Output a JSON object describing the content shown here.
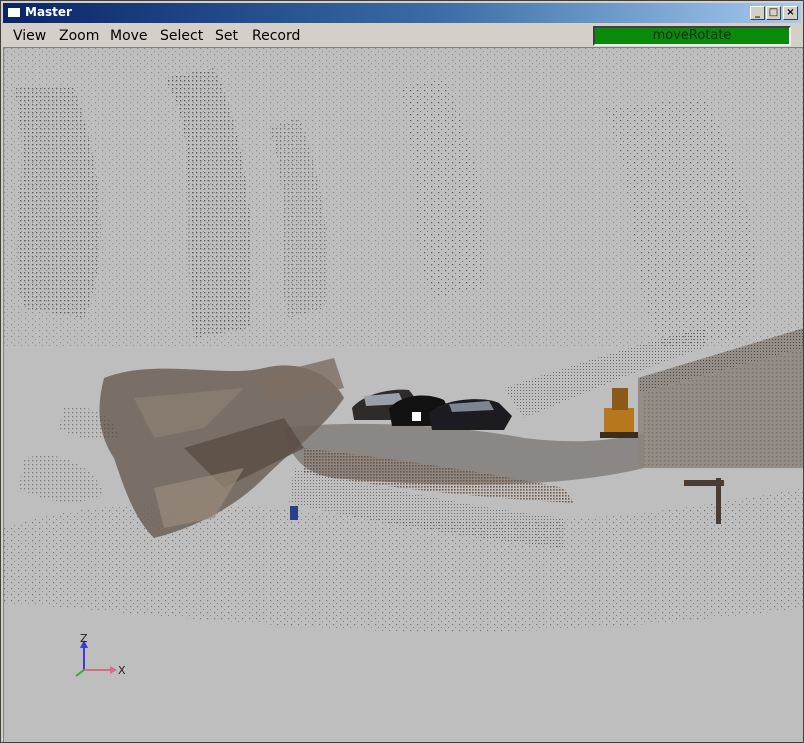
{
  "window": {
    "title": "Master",
    "controls": {
      "minimize": "_",
      "maximize": "□",
      "close": "×"
    }
  },
  "menu": {
    "items": [
      {
        "id": "view",
        "label": "View"
      },
      {
        "id": "zoom",
        "label": "Zoom"
      },
      {
        "id": "move",
        "label": "Move"
      },
      {
        "id": "select",
        "label": "Select"
      },
      {
        "id": "set",
        "label": "Set"
      },
      {
        "id": "record",
        "label": "Record"
      }
    ]
  },
  "mode": {
    "label": "moveRotate",
    "color": "#0a8a0a"
  },
  "axes": {
    "z_label": "Z",
    "x_label": "X"
  },
  "colors": {
    "viewport_bg": "#bebebe",
    "points_dark": "#3a3a3a",
    "title_bar": "#0a246a"
  }
}
